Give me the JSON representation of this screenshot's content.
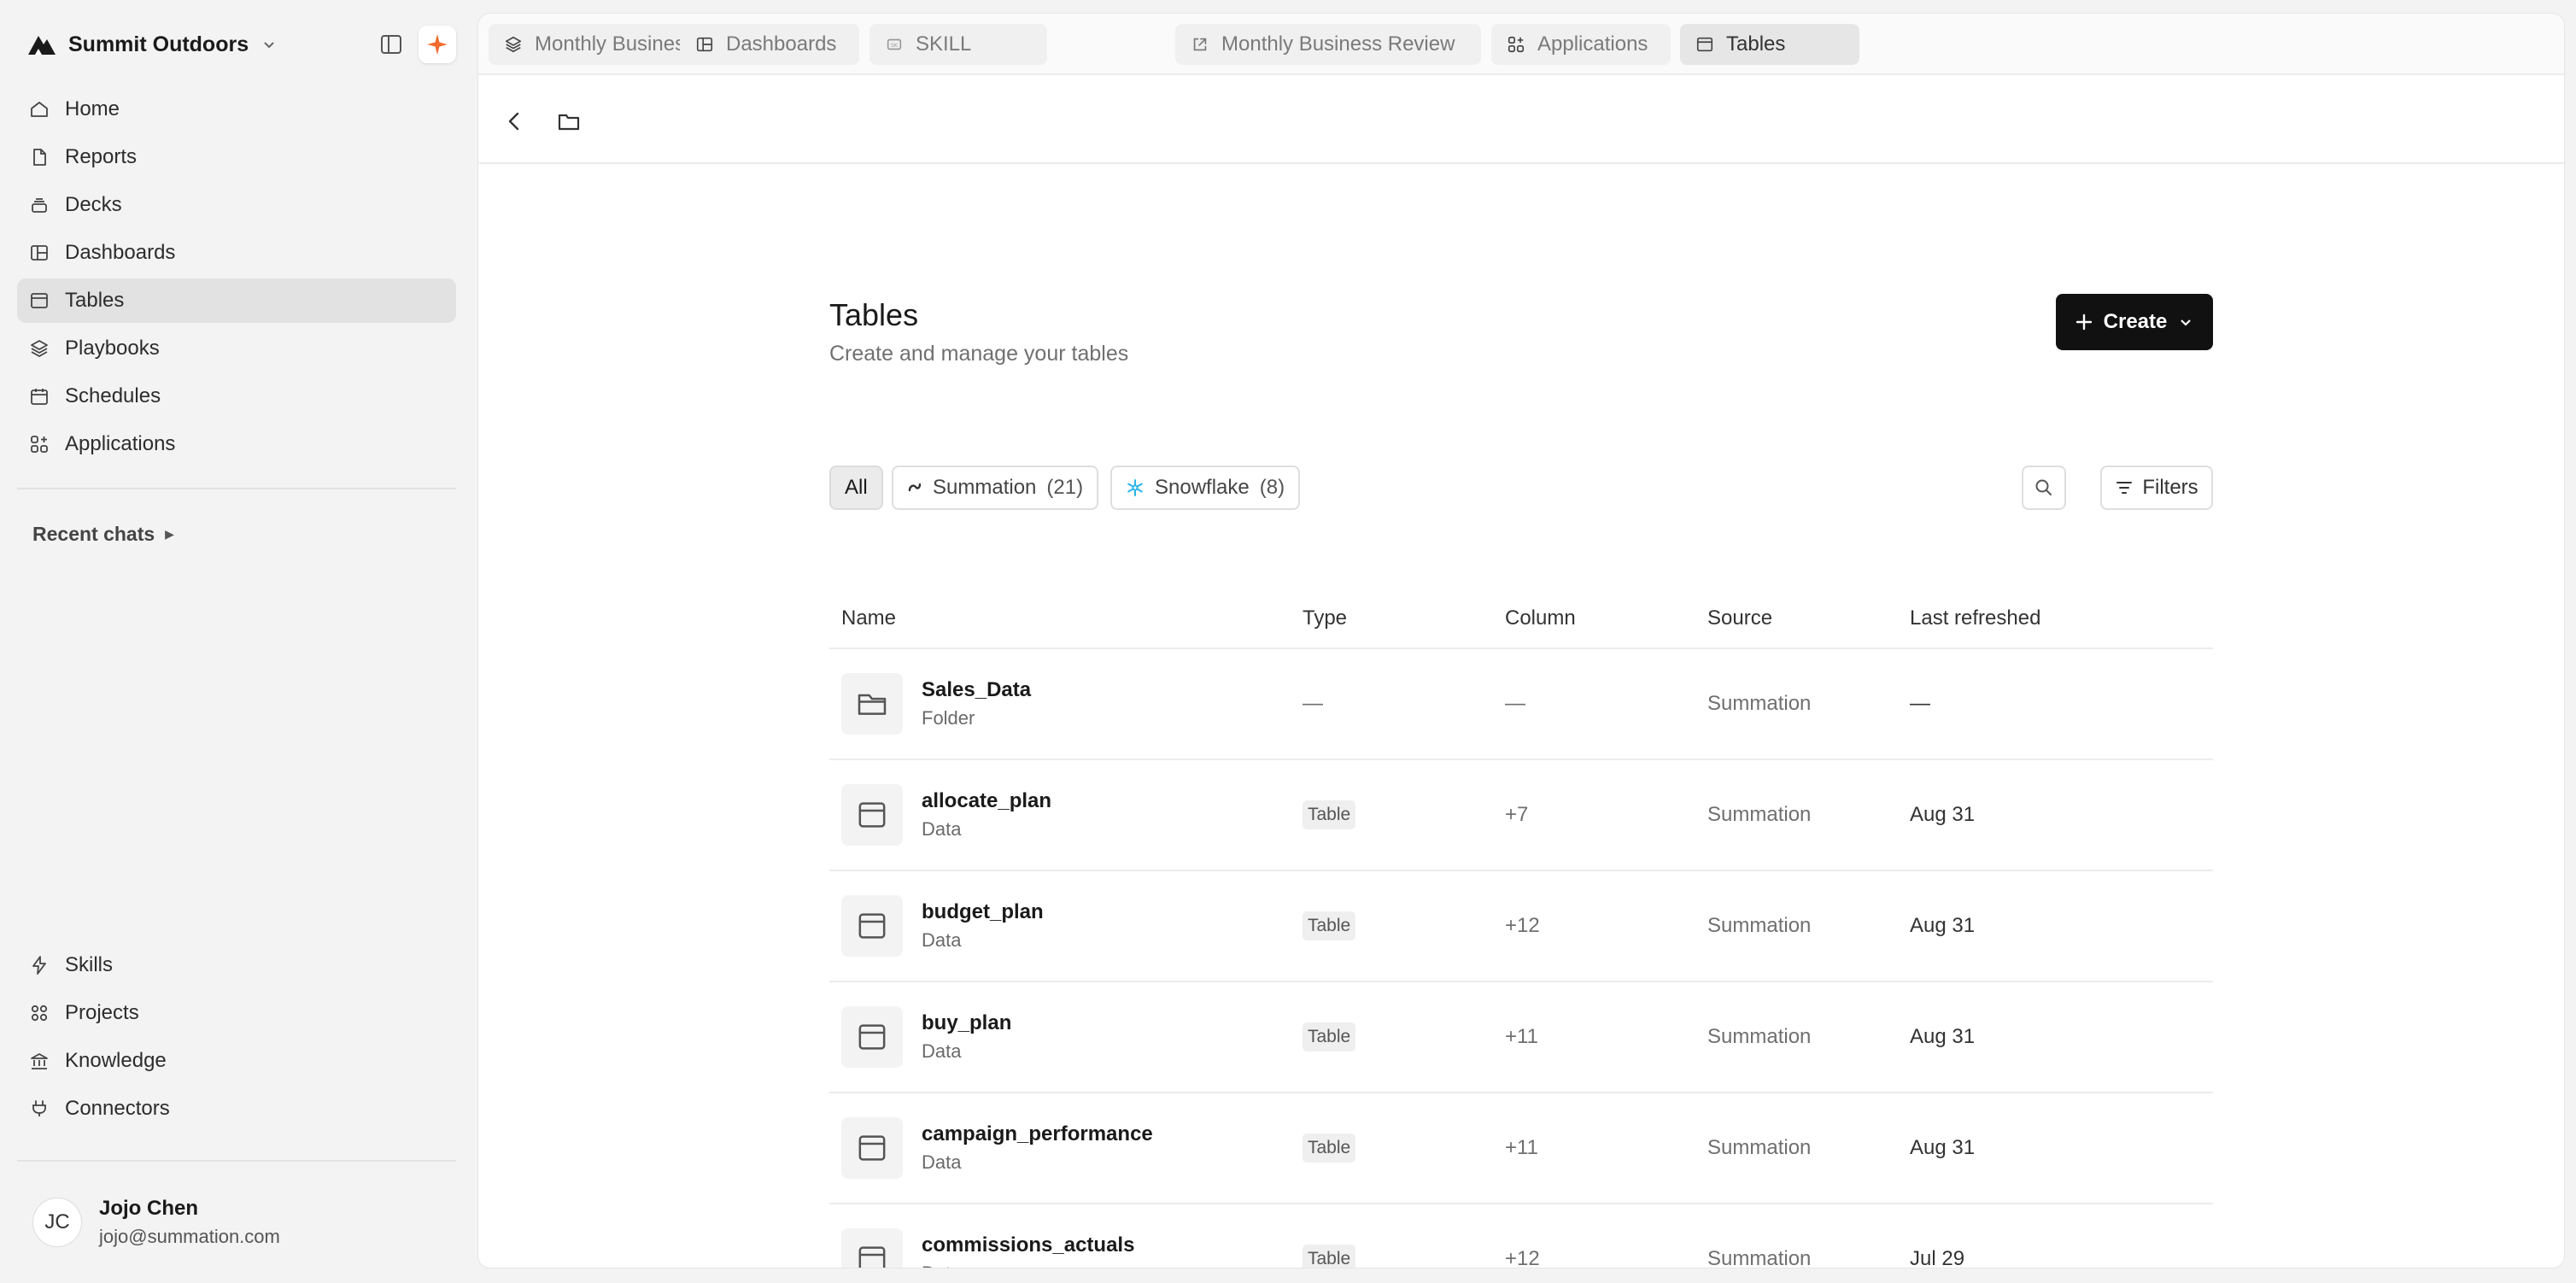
{
  "workspace": {
    "name": "Summit Outdoors"
  },
  "sidebar": {
    "nav": [
      {
        "label": "Home",
        "icon": "home-icon"
      },
      {
        "label": "Reports",
        "icon": "document-icon"
      },
      {
        "label": "Decks",
        "icon": "decks-icon"
      },
      {
        "label": "Dashboards",
        "icon": "dashboard-icon"
      },
      {
        "label": "Tables",
        "icon": "table-icon",
        "active": true
      },
      {
        "label": "Playbooks",
        "icon": "layers-icon"
      },
      {
        "label": "Schedules",
        "icon": "calendar-icon"
      },
      {
        "label": "Applications",
        "icon": "apps-icon"
      }
    ],
    "recent_chats_label": "Recent chats",
    "bottom_nav": [
      {
        "label": "Skills",
        "icon": "bolt-icon"
      },
      {
        "label": "Projects",
        "icon": "grid-icon"
      },
      {
        "label": "Knowledge",
        "icon": "bank-icon"
      },
      {
        "label": "Connectors",
        "icon": "plug-icon"
      }
    ],
    "user": {
      "initials": "JC",
      "name": "Jojo Chen",
      "email": "jojo@summation.com"
    }
  },
  "tabs": [
    {
      "label": "Monthly Business Review",
      "icon": "layers-icon"
    },
    {
      "label": "Dashboards",
      "icon": "dashboard-icon"
    },
    {
      "label": "SKILL",
      "icon": "skill-icon"
    },
    {
      "label": "Monthly Business Review",
      "icon": "external-link-icon"
    },
    {
      "label": "Applications",
      "icon": "apps-icon"
    },
    {
      "label": "Tables",
      "icon": "table-icon",
      "active": true
    }
  ],
  "page": {
    "title": "Tables",
    "subtitle": "Create and manage your tables",
    "create_label": "Create"
  },
  "filters": {
    "all_label": "All",
    "summation_label": "Summation",
    "summation_count": "(21)",
    "snowflake_label": "Snowflake",
    "snowflake_count": "(8)",
    "filters_label": "Filters"
  },
  "table": {
    "headers": [
      "Name",
      "Type",
      "Column",
      "Source",
      "Last refreshed"
    ],
    "rows": [
      {
        "name": "Sales_Data",
        "kind": "Folder",
        "type": "—",
        "column": "—",
        "source": "Summation",
        "refreshed": "—",
        "icon": "folder-icon"
      },
      {
        "name": "allocate_plan",
        "kind": "Data",
        "type": "Table",
        "column": "+7",
        "source": "Summation",
        "refreshed": "Aug 31",
        "icon": "table-icon"
      },
      {
        "name": "budget_plan",
        "kind": "Data",
        "type": "Table",
        "column": "+12",
        "source": "Summation",
        "refreshed": "Aug 31",
        "icon": "table-icon"
      },
      {
        "name": "buy_plan",
        "kind": "Data",
        "type": "Table",
        "column": "+11",
        "source": "Summation",
        "refreshed": "Aug 31",
        "icon": "table-icon"
      },
      {
        "name": "campaign_performance",
        "kind": "Data",
        "type": "Table",
        "column": "+11",
        "source": "Summation",
        "refreshed": "Aug 31",
        "icon": "table-icon"
      },
      {
        "name": "commissions_actuals",
        "kind": "Data",
        "type": "Table",
        "column": "+12",
        "source": "Summation",
        "refreshed": "Jul 29",
        "icon": "table-icon"
      }
    ]
  },
  "colors": {
    "accent": "#f26a2e",
    "primary_button": "#111111",
    "snowflake": "#29b5e8"
  }
}
